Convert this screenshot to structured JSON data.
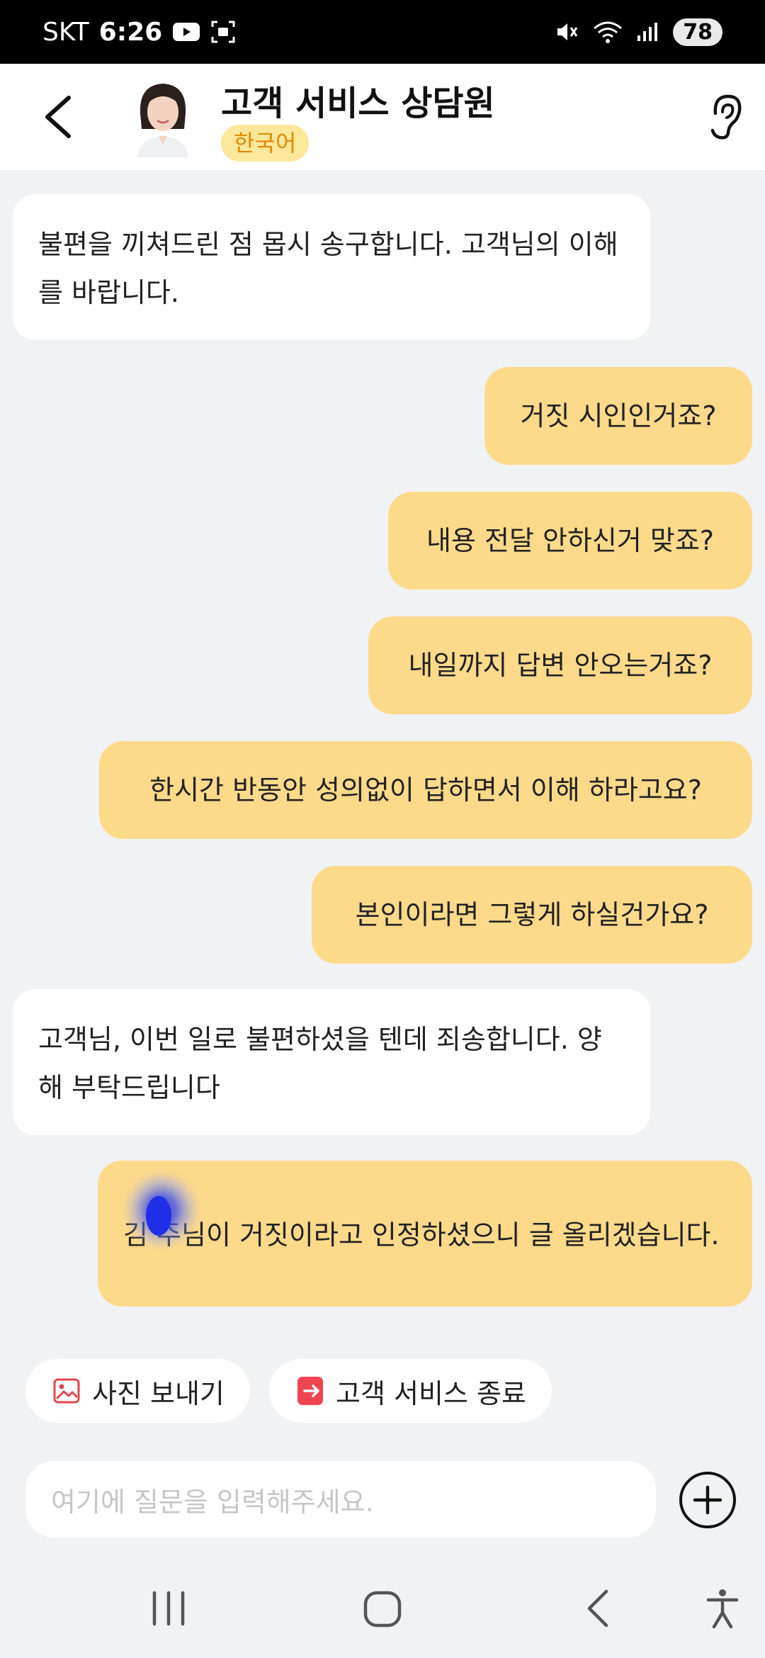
{
  "status_bar": {
    "carrier": "SKT",
    "time": "6:26",
    "battery": "78"
  },
  "header": {
    "title": "고객 서비스 상담원",
    "language": "한국어"
  },
  "messages": [
    {
      "role": "agent",
      "text": "불편을 끼쳐드린 점 몹시 송구합니다. 고객님의 이해를 바랍니다."
    },
    {
      "role": "user",
      "text": "거짓 시인인거죠?"
    },
    {
      "role": "user",
      "text": "내용 전달 안하신거 맞죠?"
    },
    {
      "role": "user",
      "text": "내일까지 답변 안오는거죠?"
    },
    {
      "role": "user",
      "text": "한시간 반동안 성의없이 답하면서 이해 하라고요?"
    },
    {
      "role": "user",
      "text": "본인이라면 그렇게 하실건가요?"
    },
    {
      "role": "agent",
      "text": "고객님, 이번 일로 불편하셨을 텐데 죄송합니다. 양해 부탁드립니다"
    },
    {
      "role": "user",
      "text": "김 주님이 거짓이라고 인정하셨으니 글 올리겠습니다."
    }
  ],
  "actions": {
    "send_photo": "사진 보내기",
    "end_service": "고객 서비스 종료"
  },
  "input": {
    "placeholder": "여기에 질문을 입력해주세요."
  },
  "colors": {
    "user_bubble": "#fdd98a",
    "agent_bubble": "#ffffff",
    "badge_bg": "#fde79b",
    "badge_text": "#e08a00",
    "photo_icon": "#e0484c",
    "end_icon": "#ef4550"
  }
}
